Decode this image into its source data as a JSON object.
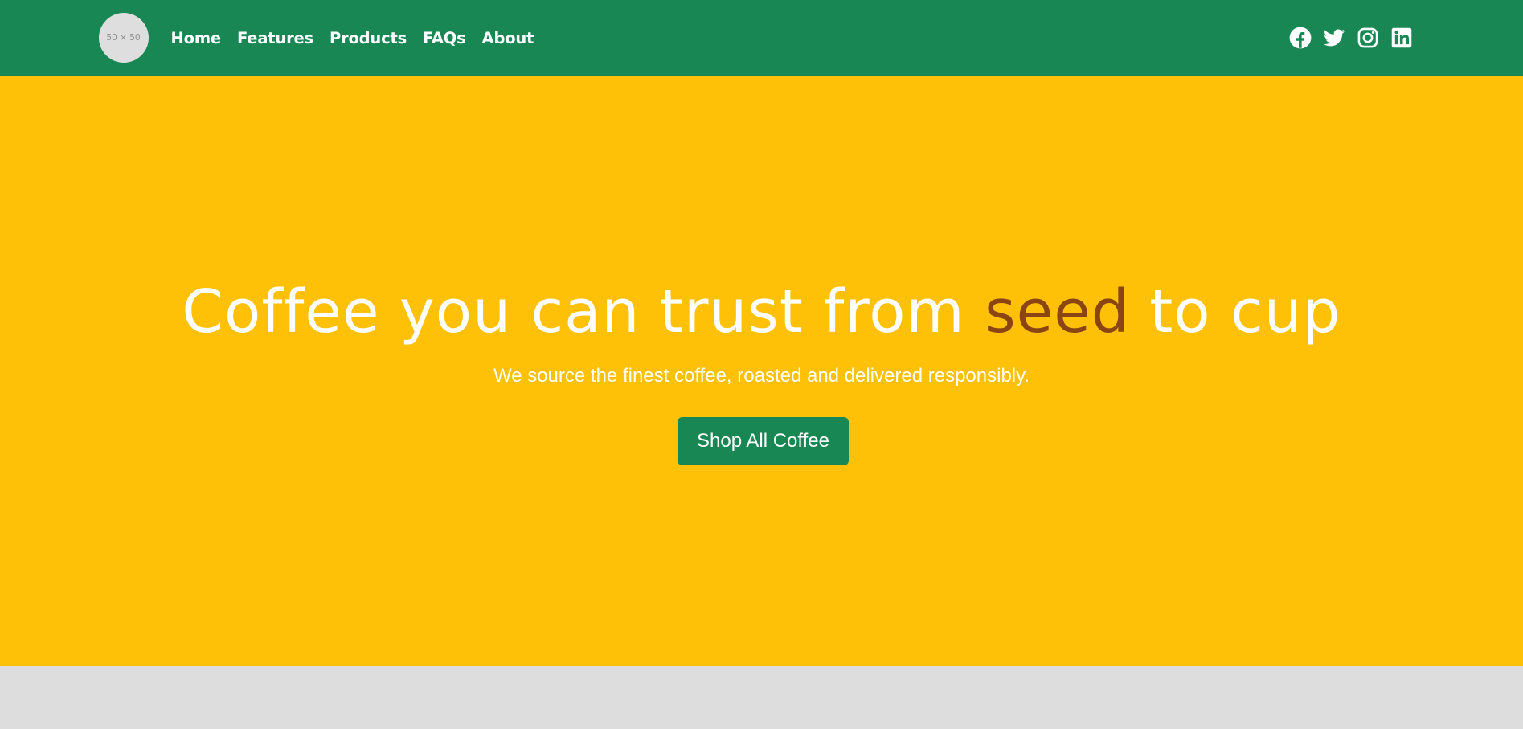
{
  "nav": {
    "logo_text": "50 × 50",
    "links": [
      {
        "label": "Home"
      },
      {
        "label": "Features"
      },
      {
        "label": "Products"
      },
      {
        "label": "FAQs"
      },
      {
        "label": "About"
      }
    ],
    "social_icons": [
      "facebook-icon",
      "twitter-icon",
      "instagram-icon",
      "linkedin-icon"
    ]
  },
  "hero": {
    "title_before": "Coffee you can trust from ",
    "title_accent": "seed",
    "title_after": " to cup",
    "subtitle": "We source the finest coffee, roasted and delivered responsibly.",
    "cta_label": "Shop All Coffee"
  },
  "colors": {
    "nav_bg": "#198754",
    "hero_bg": "#ffc107",
    "accent_text": "#8b4513",
    "button_bg": "#198754",
    "lower_section_bg": "#dddddd"
  }
}
